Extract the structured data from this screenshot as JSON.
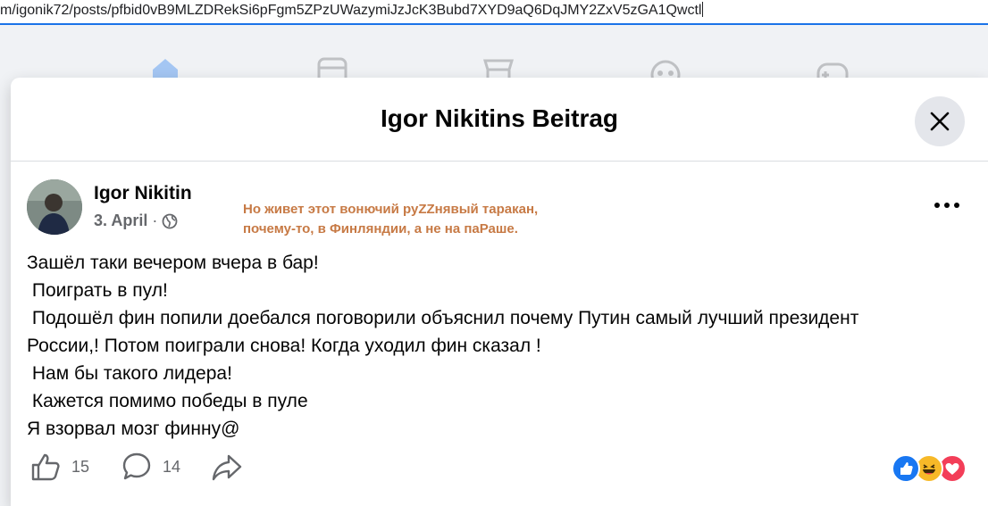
{
  "browser": {
    "url": "m/igonik72/posts/pfbid0vB9MLZDRekSi6pFgm5ZPzUWazymiJzJcK3Bubd7XYD9aQ6DqJMY2ZxV5zGA1Qwctl"
  },
  "modal": {
    "title": "Igor Nikitins Beitrag"
  },
  "post": {
    "author": "Igor Nikitin",
    "date": "3. April",
    "separator": "·",
    "annotation_lines": [
      "Но живет этот вонючий руZZнявый таракан,",
      "почему-то, в Финляндии, а не на паРаше."
    ],
    "body_lines": [
      "Зашёл таки вечером вчера в бар!",
      " Поиграть в пул!",
      " Подошёл фин попили доебался поговорили объяснил почему Путин самый лучший президент",
      "России,! Потом поиграли снова! Когда уходил фин сказал !",
      " Нам бы такого лидера!",
      " Кажется помимо победы в пуле",
      "Я взорвал мозг финну@"
    ],
    "likes": "15",
    "comments": "14"
  },
  "colors": {
    "accent": "#1a73e8",
    "annotation": "#c77a45",
    "like_blue": "#1877f2",
    "love_red": "#f33e58",
    "haha_yellow": "#f7b928"
  }
}
